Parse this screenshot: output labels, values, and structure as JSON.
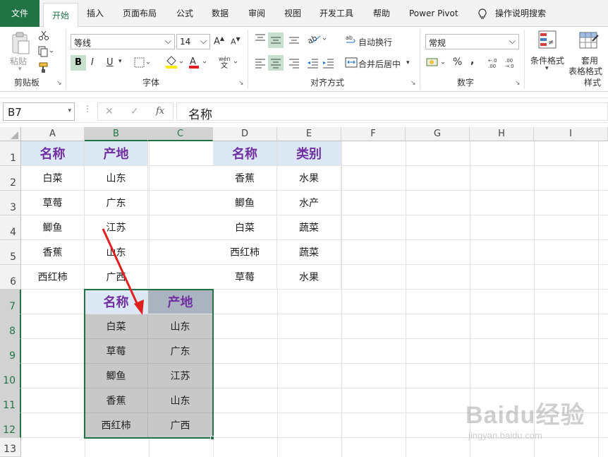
{
  "menu": {
    "file": "文件",
    "home": "开始",
    "insert": "插入",
    "layout": "页面布局",
    "formulas": "公式",
    "data": "数据",
    "review": "审阅",
    "view": "视图",
    "developer": "开发工具",
    "help": "帮助",
    "power_pivot": "Power Pivot",
    "tell_me": "操作说明搜索"
  },
  "ribbon": {
    "clipboard": {
      "paste": "粘贴",
      "label": "剪贴板"
    },
    "font": {
      "name": "等线",
      "size": "14",
      "bold": "B",
      "italic": "I",
      "underline": "U",
      "phonetic": "wén",
      "label": "字体"
    },
    "alignment": {
      "wrap": "自动换行",
      "merge": "合并后居中",
      "label": "对齐方式"
    },
    "number": {
      "format": "常规",
      "percent": "%",
      "comma": ",",
      "label": "数字"
    },
    "styles": {
      "conditional": "条件格式",
      "table1": "套用",
      "table2": "表格格式",
      "label": "样式"
    }
  },
  "formula_bar": {
    "name_box": "B7",
    "content": "名称"
  },
  "columns": [
    "A",
    "B",
    "C",
    "D",
    "E",
    "F",
    "G",
    "H",
    "I"
  ],
  "rows": [
    "1",
    "2",
    "3",
    "4",
    "5",
    "6",
    "7",
    "8",
    "9",
    "10",
    "11",
    "12",
    "13"
  ],
  "table1": {
    "headers": [
      "名称",
      "产地"
    ],
    "rows": [
      [
        "白菜",
        "山东"
      ],
      [
        "草莓",
        "广东"
      ],
      [
        "鲫鱼",
        "江苏"
      ],
      [
        "香蕉",
        "山东"
      ],
      [
        "西红柿",
        "广西"
      ]
    ]
  },
  "table2": {
    "headers": [
      "名称",
      "类别"
    ],
    "rows": [
      [
        "香蕉",
        "水果"
      ],
      [
        "鲫鱼",
        "水产"
      ],
      [
        "白菜",
        "蔬菜"
      ],
      [
        "西红柿",
        "蔬菜"
      ],
      [
        "草莓",
        "水果"
      ]
    ]
  },
  "pasted": {
    "headers": [
      "名称",
      "产地"
    ],
    "rows": [
      [
        "白菜",
        "山东"
      ],
      [
        "草莓",
        "广东"
      ],
      [
        "鲫鱼",
        "江苏"
      ],
      [
        "香蕉",
        "山东"
      ],
      [
        "西红柿",
        "广西"
      ]
    ]
  },
  "watermark": {
    "brand": "Baidu经验",
    "url": "jingyan.baidu.com"
  },
  "colors": {
    "excel_green": "#217346",
    "header_text": "#7030a0",
    "header_fill": "#dce9f5",
    "selection_fill": "#c8c8c8",
    "arrow": "#e02020"
  }
}
